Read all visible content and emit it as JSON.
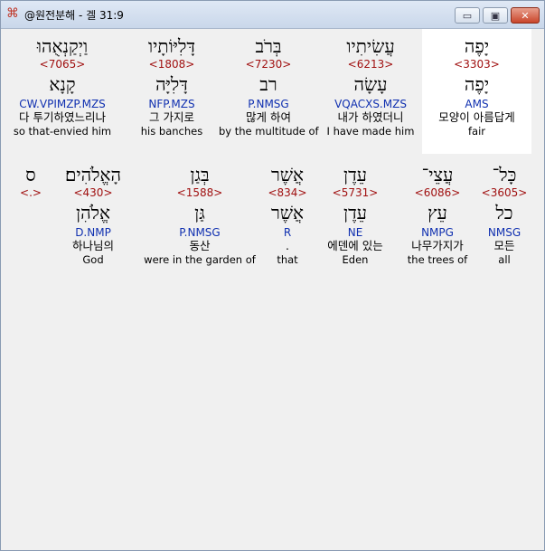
{
  "window": {
    "title": "@원전분해 - 겔 31:9"
  },
  "controls": {
    "minimize": "▭",
    "maximize": "▣",
    "close": "✕"
  },
  "rows": [
    {
      "words": [
        {
          "hebrew": "וַיְקַנְאֻהוּ",
          "strong": "<7065>",
          "lexeme": "קָנָא",
          "parse": "CW.VPIMZP.MZS",
          "korean": "다 투기하였느리나",
          "english": "so that-envied him"
        },
        {
          "hebrew": "דָּלִיּוֹתָיו",
          "strong": "<1808>",
          "lexeme": "דָּלִיָּה",
          "parse": "NFP.MZS",
          "korean": "그 가지로",
          "english": "his banches"
        },
        {
          "hebrew": "בְּרֹב",
          "strong": "<7230>",
          "lexeme": "רב",
          "parse": "P.NMSG",
          "korean": "많게 하여",
          "english": "by the multitude of"
        },
        {
          "hebrew": "עֲשִׂיתִיו",
          "strong": "<6213>",
          "lexeme": "עָשָׂה",
          "parse": "VQACXS.MZS",
          "korean": "내가 하였더니",
          "english": "I have made him"
        },
        {
          "hebrew": "יָפֶה",
          "strong": "<3303>",
          "lexeme": "יָפֶה",
          "parse": "AMS",
          "korean": "모양이 아름답게",
          "english": "fair",
          "selected": true
        }
      ]
    },
    {
      "words": [
        {
          "hebrew": "ס",
          "strong": "<.>",
          "lexeme": "",
          "parse": "",
          "korean": "",
          "english": ""
        },
        {
          "hebrew": "הָאֱלֹהִים׃",
          "strong": "<430>",
          "lexeme": "אֱלֹהִן",
          "parse": "D.NMP",
          "korean": "하나님의",
          "english": "God"
        },
        {
          "hebrew": "בְּגַן",
          "strong": "<1588>",
          "lexeme": "גַּן",
          "parse": "P.NMSG",
          "korean": "동산",
          "english": "were in the garden of"
        },
        {
          "hebrew": "אֲשֶׁר",
          "strong": "<834>",
          "lexeme": "אֲשֶׁר",
          "parse": "R",
          "korean": ".",
          "english": "that"
        },
        {
          "hebrew": "עֵדֶן",
          "strong": "<5731>",
          "lexeme": "עֵדֶן",
          "parse": "NE",
          "korean": "에덴에 있는",
          "english": "Eden"
        },
        {
          "hebrew": "עֲצֵי־",
          "strong": "<6086>",
          "lexeme": "עֵץ",
          "parse": "NMPG",
          "korean": "나무가지가",
          "english": "the trees of"
        },
        {
          "hebrew": "כָּל־",
          "strong": "<3605>",
          "lexeme": "כל",
          "parse": "NMSG",
          "korean": "모든",
          "english": "all"
        }
      ]
    }
  ]
}
